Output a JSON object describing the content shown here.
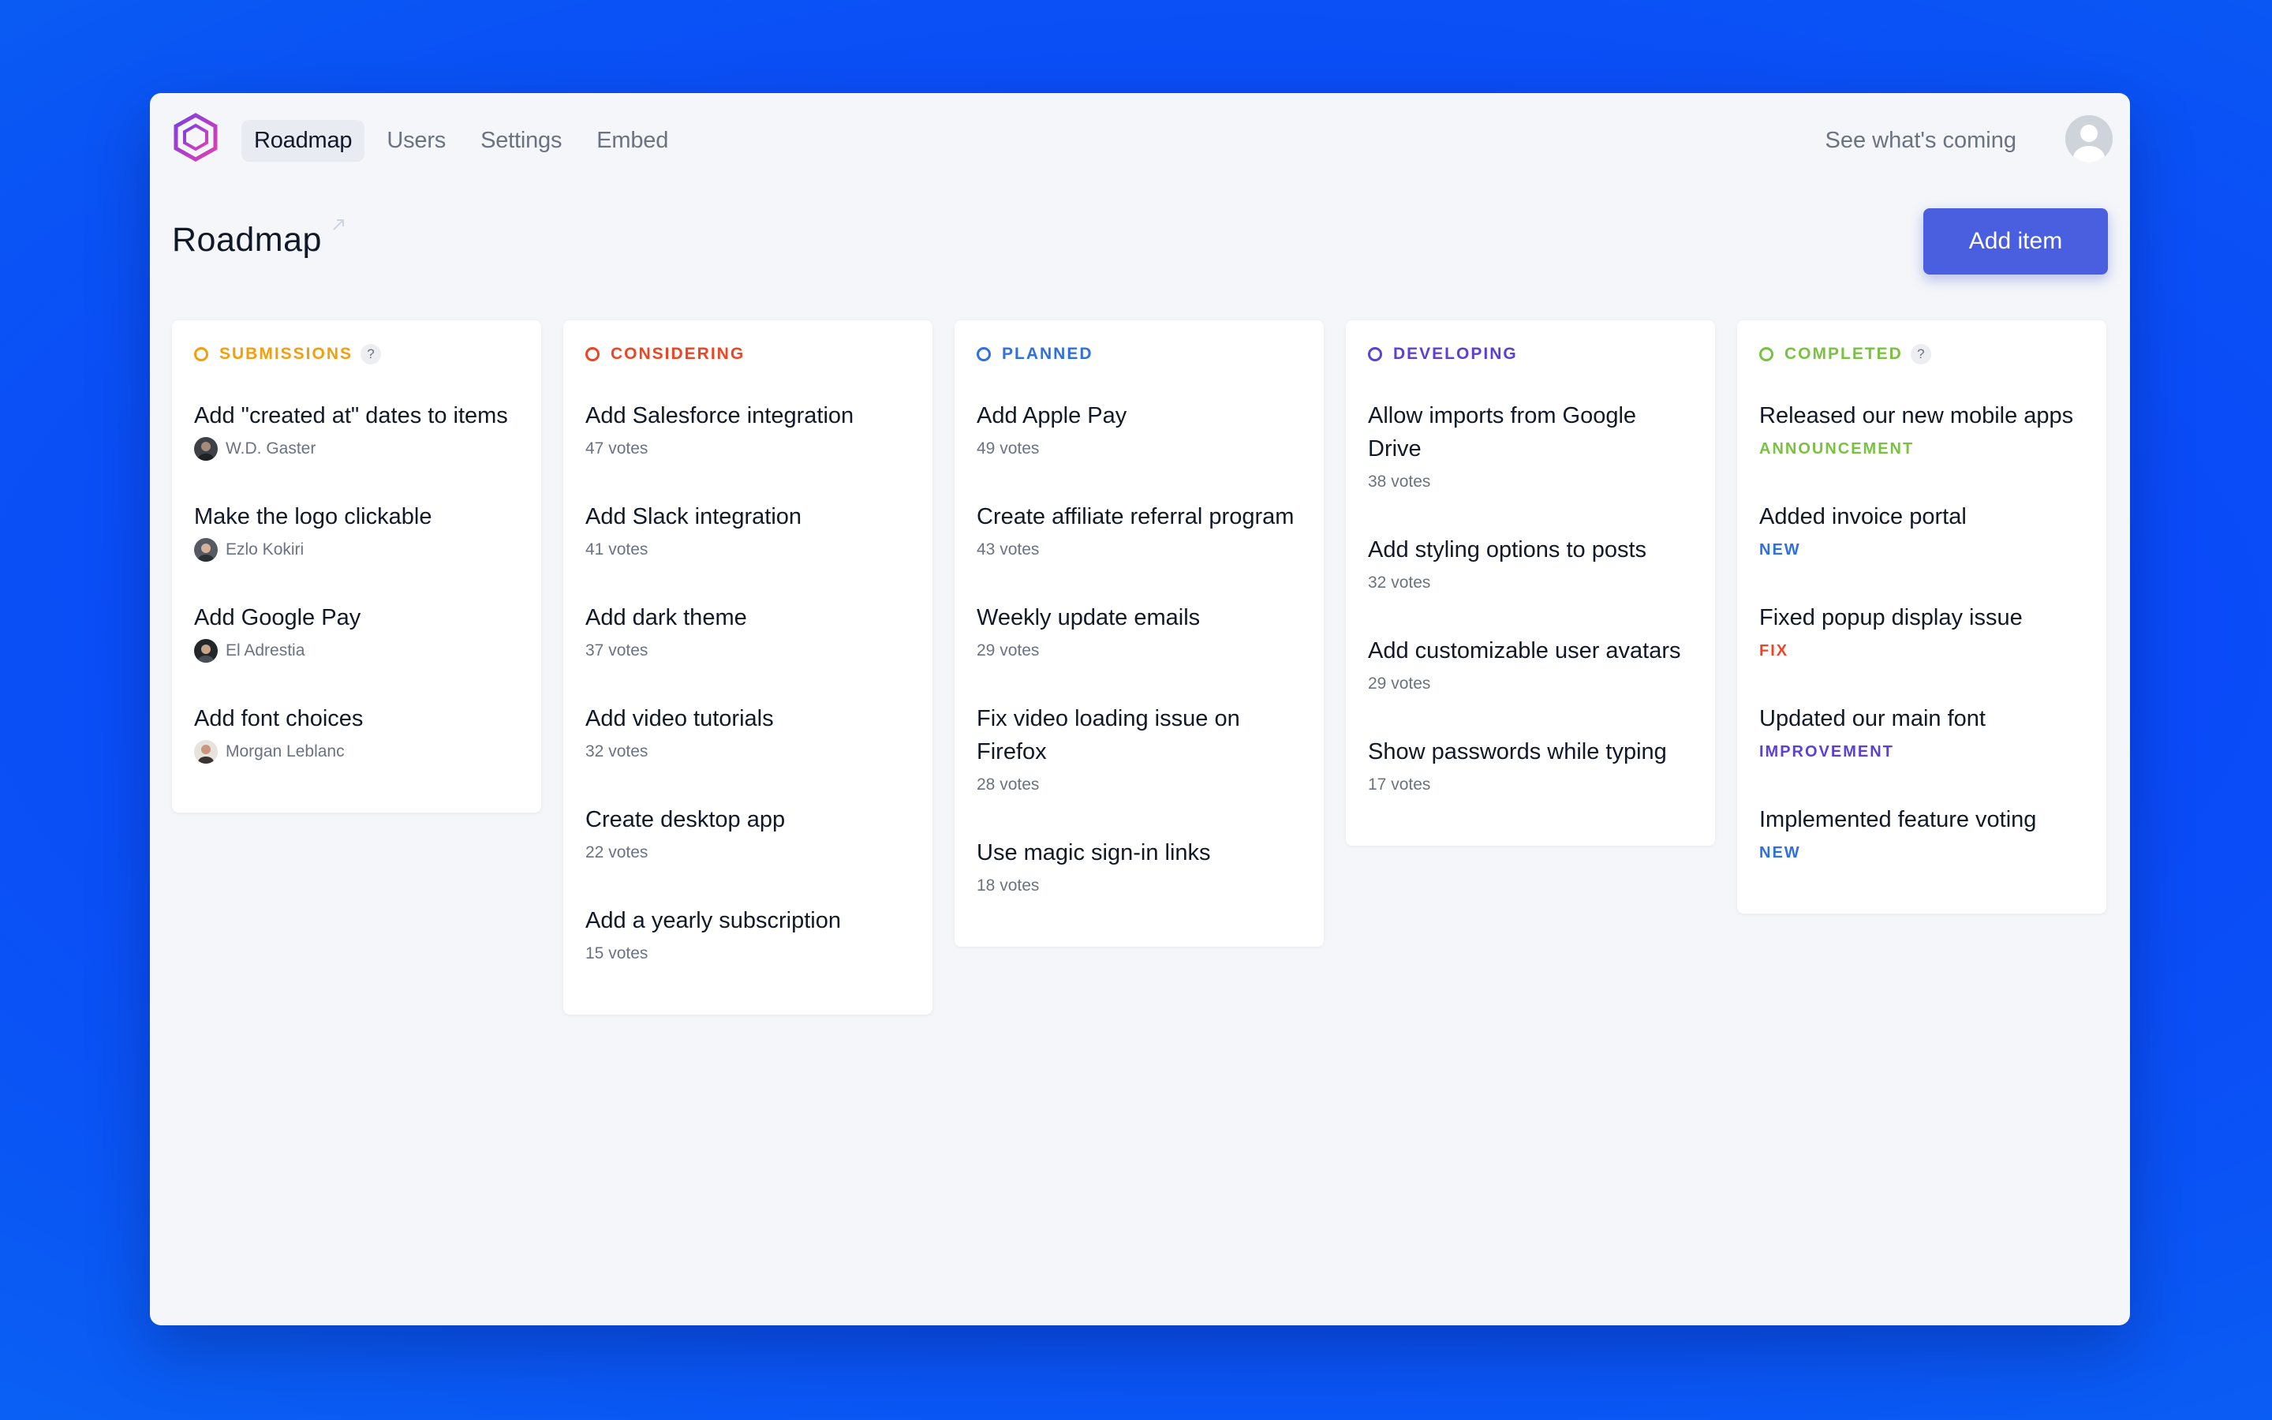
{
  "nav": {
    "tabs": [
      {
        "label": "Roadmap",
        "active": true
      },
      {
        "label": "Users",
        "active": false
      },
      {
        "label": "Settings",
        "active": false
      },
      {
        "label": "Embed",
        "active": false
      }
    ],
    "see_coming": "See what's coming"
  },
  "page": {
    "title": "Roadmap",
    "add_item_label": "Add item"
  },
  "colors": {
    "accent": "#4a5fe0",
    "submissions": "#f59e0b",
    "considering": "#ef4423",
    "planned": "#2f6fe0",
    "developing": "#5b3fd6",
    "completed": "#7ac142",
    "announcement": "#7ac142",
    "new": "#2f6fe0",
    "fix": "#ef4423",
    "improvement": "#5b3fd6"
  },
  "columns": {
    "submissions": {
      "title": "SUBMISSIONS",
      "help": "?",
      "items": [
        {
          "title": "Add \"created at\" dates to items",
          "author": "W.D. Gaster"
        },
        {
          "title": "Make the logo clickable",
          "author": "Ezlo Kokiri"
        },
        {
          "title": "Add Google Pay",
          "author": "El Adrestia"
        },
        {
          "title": "Add font choices",
          "author": "Morgan Leblanc"
        }
      ]
    },
    "considering": {
      "title": "CONSIDERING",
      "items": [
        {
          "title": "Add Salesforce integration",
          "votes": "47 votes"
        },
        {
          "title": "Add Slack integration",
          "votes": "41 votes"
        },
        {
          "title": "Add dark theme",
          "votes": "37 votes"
        },
        {
          "title": "Add video tutorials",
          "votes": "32 votes"
        },
        {
          "title": "Create desktop app",
          "votes": "22 votes"
        },
        {
          "title": "Add a yearly subscription",
          "votes": "15 votes"
        }
      ]
    },
    "planned": {
      "title": "PLANNED",
      "items": [
        {
          "title": "Add Apple Pay",
          "votes": "49 votes"
        },
        {
          "title": "Create affiliate referral program",
          "votes": "43 votes"
        },
        {
          "title": "Weekly update emails",
          "votes": "29 votes"
        },
        {
          "title": "Fix video loading issue on Firefox",
          "votes": "28 votes"
        },
        {
          "title": "Use magic sign-in links",
          "votes": "18 votes"
        }
      ]
    },
    "developing": {
      "title": "DEVELOPING",
      "items": [
        {
          "title": "Allow imports from Google Drive",
          "votes": "38 votes"
        },
        {
          "title": "Add styling options to posts",
          "votes": "32 votes"
        },
        {
          "title": "Add customizable user avatars",
          "votes": "29 votes"
        },
        {
          "title": "Show passwords while typing",
          "votes": "17 votes"
        }
      ]
    },
    "completed": {
      "title": "COMPLETED",
      "help": "?",
      "items": [
        {
          "title": "Released our new mobile apps",
          "tag": "ANNOUNCEMENT"
        },
        {
          "title": "Added invoice portal",
          "tag": "NEW"
        },
        {
          "title": "Fixed popup display issue",
          "tag": "FIX"
        },
        {
          "title": "Updated our main font",
          "tag": "IMPROVEMENT"
        },
        {
          "title": "Implemented feature voting",
          "tag": "NEW"
        }
      ]
    }
  }
}
